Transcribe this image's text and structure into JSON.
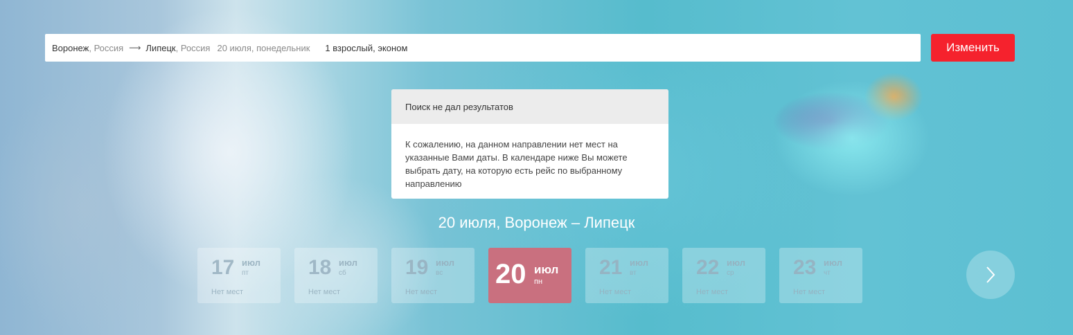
{
  "search": {
    "from_city": "Воронеж",
    "from_country": "Россия",
    "to_city": "Липецк",
    "to_country": "Россия",
    "date": "20 июля, понедельник",
    "passengers": "1 взрослый, эконом",
    "change_label": "Изменить"
  },
  "notice": {
    "title": "Поиск не дал результатов",
    "message": "К сожалению, на данном направлении нет мест на указанные Вами даты. В календаре ниже Вы можете выбрать дату, на которую есть рейс по выбранному направлению"
  },
  "route_title": "20 июля,  Воронеж –  Липецк",
  "calendar": {
    "days": [
      {
        "num": "17",
        "month": "июл",
        "weekday": "пт",
        "status": "Нет мест"
      },
      {
        "num": "18",
        "month": "июл",
        "weekday": "сб",
        "status": "Нет мест"
      },
      {
        "num": "19",
        "month": "июл",
        "weekday": "вс",
        "status": "Нет мест"
      },
      {
        "num": "20",
        "month": "июл",
        "weekday": "пн",
        "status": ""
      },
      {
        "num": "21",
        "month": "июл",
        "weekday": "вт",
        "status": "Нет мест"
      },
      {
        "num": "22",
        "month": "июл",
        "weekday": "ср",
        "status": "Нет мест"
      },
      {
        "num": "23",
        "month": "июл",
        "weekday": "чт",
        "status": "Нет мест"
      }
    ],
    "active_index": 3,
    "next_icon": "chevron-right-icon"
  },
  "colors": {
    "accent": "#f5222d",
    "active_day": "#c9707f"
  }
}
